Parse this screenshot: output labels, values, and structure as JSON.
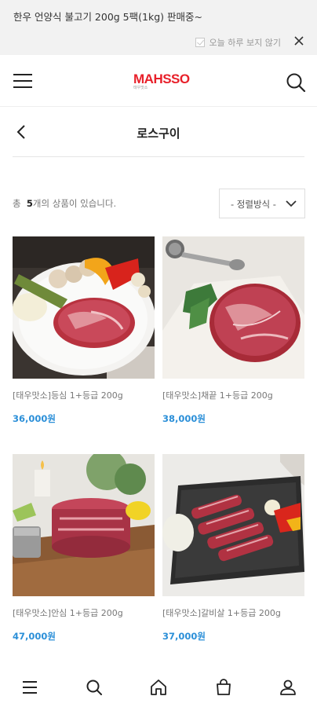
{
  "promo": {
    "text": "한우 언양식 불고기 200g 5팩(1kg) 판매중~",
    "dont_show_today": "오늘 하루 보지 않기"
  },
  "header": {
    "logo": "MAHSSO",
    "logo_sub": "태우맛소"
  },
  "page": {
    "title": "로스구이"
  },
  "listing": {
    "count_prefix": "총",
    "count": "5",
    "count_suffix": "개의 상품이 있습니다.",
    "sort_label": "- 정렬방식 -"
  },
  "products": [
    {
      "name": "[태우맛소]등심 1+등급 200g",
      "price": "36,000원"
    },
    {
      "name": "[태우맛소]채끝 1+등급 200g",
      "price": "38,000원"
    },
    {
      "name": "[태우맛소]안심 1+등급 200g",
      "price": "47,000원"
    },
    {
      "name": "[태우맛소]갈비살 1+등급 200g",
      "price": "37,000원"
    }
  ],
  "colors": {
    "accent_price": "#2b8fd8",
    "brand_red": "#e8202a",
    "promo_bg": "#f2f2f2"
  },
  "icons": {
    "nav": [
      "menu-icon",
      "search-icon",
      "home-icon",
      "cart-icon",
      "user-icon"
    ]
  }
}
